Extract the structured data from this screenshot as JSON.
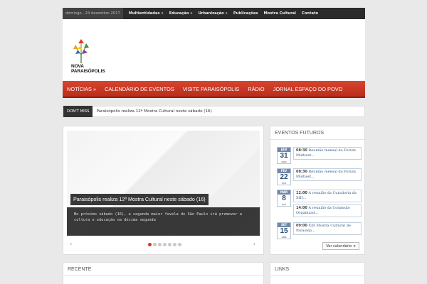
{
  "topbar": {
    "date": "domingo , 24 dezembro 2017",
    "nav": [
      "Multientidades »",
      "Educação »",
      "Urbanização »",
      "Publicações",
      "Mostra Cultural",
      "Contato"
    ]
  },
  "logo": {
    "line1": "NOVA",
    "line2": "PARAISÓPOLIS"
  },
  "mainnav": [
    "NOTÍCIAS »",
    "CALENDÁRIO DE EVENTOS",
    "VISITE PARAISÓPOLIS",
    "RÁDIO",
    "JORNAL ESPAÇO DO POVO"
  ],
  "ticker": {
    "label": "DON'T MISS",
    "text": "Paraisópolis realiza 12ª Mostra Cultural neste sábado (16)"
  },
  "slider": {
    "title": "Paraisópolis realiza 12ª Mostra Cultural neste sábado (16)",
    "desc": "No próximo sábado (16), a segunda maior favela de São Paulo irá promover a cultura e educação na décima segunda",
    "prev": "‹",
    "next": "›",
    "slide_count": 7,
    "active_slide": 1
  },
  "events": {
    "title": "EVENTOS FUTUROS",
    "items": [
      {
        "month": "JAN",
        "day": "31",
        "weekday": "qua",
        "entries": [
          {
            "time": "08:30",
            "text": "Reunião mensal do Forum Multiest..."
          }
        ]
      },
      {
        "month": "FEV",
        "day": "22",
        "weekday": "qui",
        "entries": [
          {
            "time": "08:30",
            "text": "Reunião mensal do Forum Multiest..."
          }
        ]
      },
      {
        "month": "MAR",
        "day": "8",
        "weekday": "qui",
        "entries": [
          {
            "time": "12:00",
            "text": "A reunião da Curadoria da XIII..."
          },
          {
            "time": "14:00",
            "text": "A reunião da Comissão Organizad..."
          }
        ]
      },
      {
        "month": "SET",
        "day": "15",
        "weekday": "sáb",
        "entries": [
          {
            "time": "09:00",
            "text": "XIII Mostra Cultural de Paraisóp..."
          }
        ]
      }
    ],
    "more": "Ver calendário ➜"
  },
  "recent": {
    "title": "RECENTE"
  },
  "links": {
    "title": "LINKS"
  },
  "colors": {
    "accent": "#c8351f",
    "dark": "#2b2b2b",
    "calendar": "#6f88a8"
  }
}
